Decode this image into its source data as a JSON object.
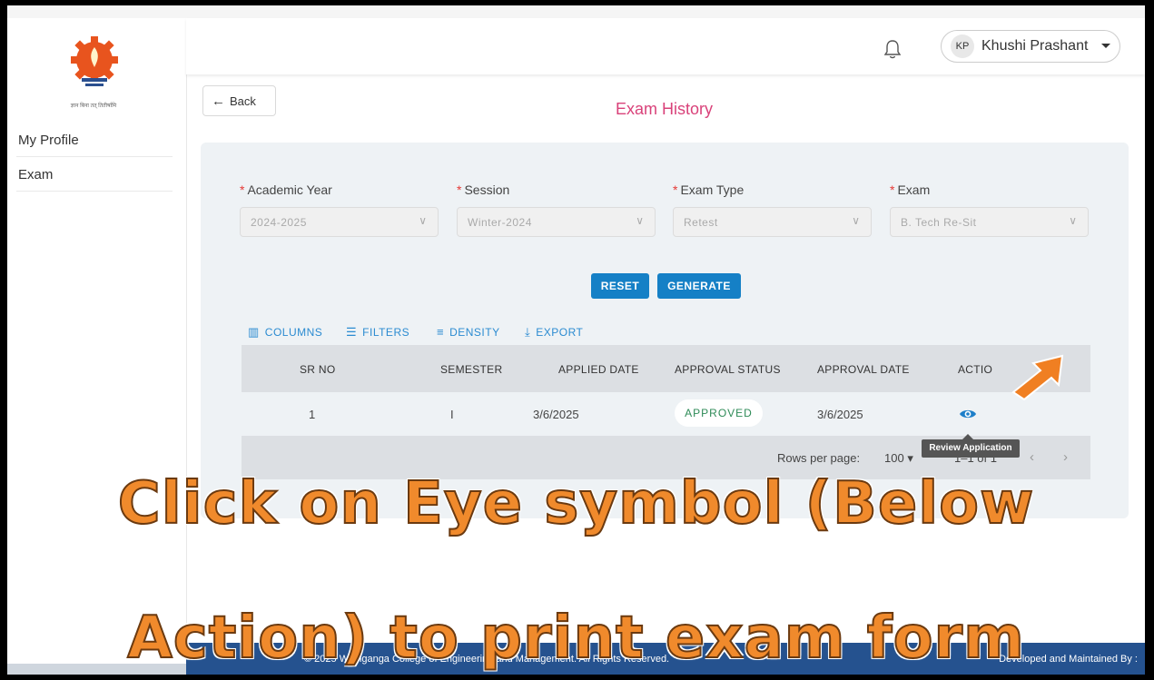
{
  "sidebar": {
    "logo_tagline": "ज्ञान बिना तत् तितीर्षामि",
    "items": [
      {
        "label": "My Profile"
      },
      {
        "label": "Exam"
      }
    ]
  },
  "header": {
    "user_initials": "KP",
    "user_name": "Khushi Prashant"
  },
  "page": {
    "back_label": "Back",
    "title": "Exam History"
  },
  "filters": [
    {
      "label": "Academic Year",
      "value": "2024-2025"
    },
    {
      "label": "Session",
      "value": "Winter-2024"
    },
    {
      "label": "Exam Type",
      "value": "Retest"
    },
    {
      "label": "Exam",
      "value": "B. Tech Re-Sit"
    }
  ],
  "buttons": {
    "reset": "RESET",
    "generate": "GENERATE"
  },
  "toolbar": {
    "columns": "COLUMNS",
    "filters": "FILTERS",
    "density": "DENSITY",
    "export": "EXPORT"
  },
  "table": {
    "headers": [
      "SR NO",
      "SEMESTER",
      "APPLIED DATE",
      "APPROVAL STATUS",
      "APPROVAL DATE",
      "ACTIO"
    ],
    "rows": [
      {
        "sr_no": "1",
        "semester": "I",
        "applied_date": "3/6/2025",
        "approval_status": "APPROVED",
        "approval_date": "3/6/2025"
      }
    ],
    "rows_per_page_label": "Rows per page:",
    "rows_per_page_value": "100",
    "pagination": "1–1 of 1",
    "action_tooltip": "Review Application"
  },
  "footer": {
    "left": "© 2025 Wainganga College of Engineering and Management. All Rights Reserved.",
    "right": "Developed and Maintained By :"
  },
  "overlay": {
    "line1": "Click on Eye symbol (Below",
    "line2": "Action) to print exam form"
  },
  "colors": {
    "accent_blue": "#1580c6",
    "title_pink": "#d9427a",
    "approved_green": "#2e8b57",
    "overlay_orange": "#f08a2c",
    "footer_blue": "#25528f"
  }
}
